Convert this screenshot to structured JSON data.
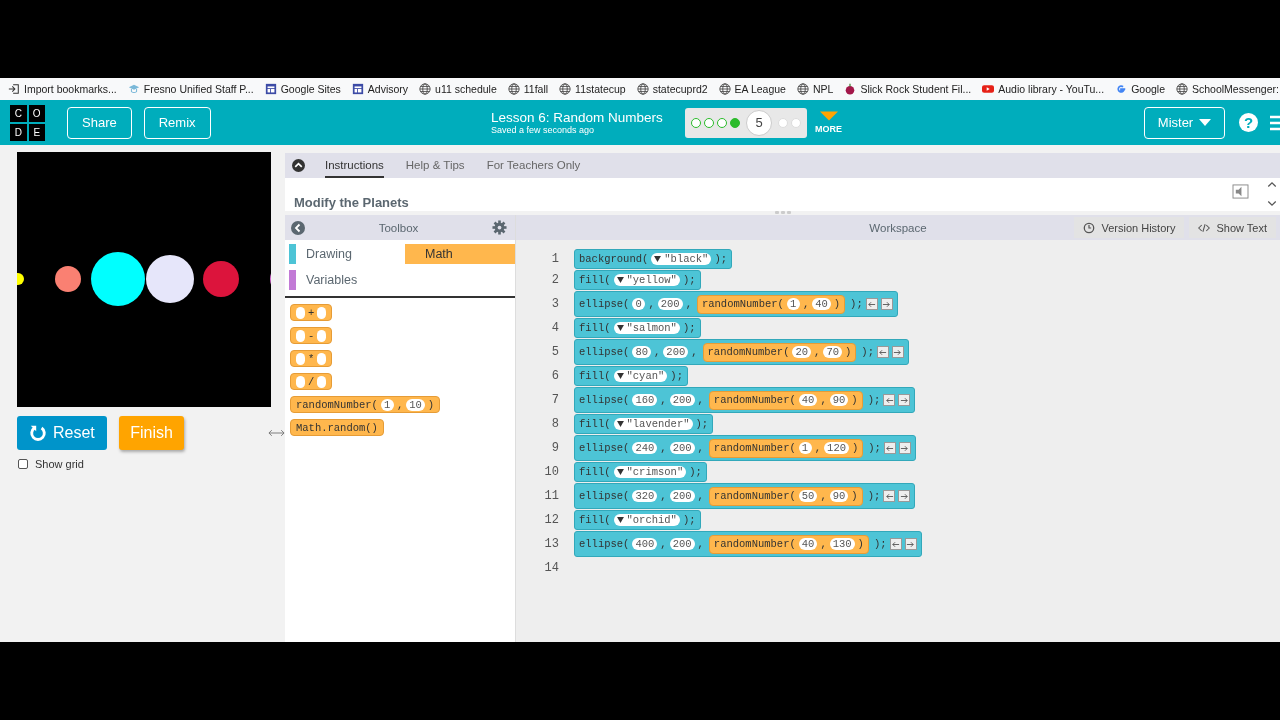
{
  "bookmarks": [
    {
      "kind": "import",
      "label": "Import bookmarks..."
    },
    {
      "kind": "cap",
      "label": "Fresno Unified Staff P..."
    },
    {
      "kind": "sites",
      "label": "Google Sites"
    },
    {
      "kind": "sites",
      "label": "Advisory"
    },
    {
      "kind": "globe",
      "label": "u11 schedule"
    },
    {
      "kind": "globe",
      "label": "11fall"
    },
    {
      "kind": "globe",
      "label": "11statecup"
    },
    {
      "kind": "globe",
      "label": "statecuprd2"
    },
    {
      "kind": "globe",
      "label": "EA League"
    },
    {
      "kind": "globe",
      "label": "NPL"
    },
    {
      "kind": "apple",
      "label": "Slick Rock Student Fil..."
    },
    {
      "kind": "youtube",
      "label": "Audio library - YouTu..."
    },
    {
      "kind": "google",
      "label": "Google"
    },
    {
      "kind": "globe",
      "label": "SchoolMessenger:"
    }
  ],
  "header": {
    "logo": [
      "C",
      "O",
      "D",
      "E"
    ],
    "buttons": [
      "Share",
      "Remix"
    ],
    "title": "Lesson 6: Random Numbers",
    "subtitle": "Saved a few seconds ago",
    "progress": [
      {
        "kind": "dot",
        "attempted": true,
        "perfect": false
      },
      {
        "kind": "dot",
        "attempted": true,
        "perfect": false
      },
      {
        "kind": "dot",
        "attempted": true,
        "perfect": false
      },
      {
        "kind": "dot",
        "attempted": true,
        "perfect": true
      },
      {
        "kind": "current",
        "label": "5"
      },
      {
        "kind": "dot",
        "attempted": false,
        "perfect": false
      },
      {
        "kind": "dot",
        "attempted": false,
        "perfect": false
      }
    ],
    "more": "MORE",
    "user": "Mister",
    "help": "?"
  },
  "stage": {
    "buttons": [
      {
        "kind": "reset",
        "label": "Reset"
      },
      {
        "kind": "finish",
        "label": "Finish"
      }
    ],
    "show_grid": {
      "label": "Show grid",
      "checked": false
    }
  },
  "instructions": {
    "tabs": [
      {
        "label": "Instructions",
        "selected": true
      },
      {
        "label": "Help & Tips",
        "selected": false
      },
      {
        "label": "For Teachers Only",
        "selected": false
      }
    ],
    "heading": "Modify the Planets"
  },
  "toolbox": {
    "title": "Toolbox",
    "categories": [
      {
        "label": "Drawing",
        "color": "#4dc4d6",
        "selected": false
      },
      {
        "label": "Math",
        "color": "#ffb74d",
        "selected": true
      },
      {
        "label": "Variables",
        "color": "#c27ad6",
        "selected": false
      }
    ],
    "blocks": [
      {
        "parts": [
          {
            "kind": "slot"
          },
          {
            "kind": "text",
            "text": "+"
          },
          {
            "kind": "slot"
          }
        ]
      },
      {
        "parts": [
          {
            "kind": "slot"
          },
          {
            "kind": "text",
            "text": "-"
          },
          {
            "kind": "slot"
          }
        ]
      },
      {
        "parts": [
          {
            "kind": "slot"
          },
          {
            "kind": "text",
            "text": "*"
          },
          {
            "kind": "slot"
          }
        ]
      },
      {
        "parts": [
          {
            "kind": "slot"
          },
          {
            "kind": "text",
            "text": "/"
          },
          {
            "kind": "slot"
          }
        ]
      },
      {
        "parts": [
          {
            "kind": "text",
            "text": "randomNumber("
          },
          {
            "kind": "num",
            "text": "1"
          },
          {
            "kind": "text",
            "text": ","
          },
          {
            "kind": "num",
            "text": "10"
          },
          {
            "kind": "text",
            "text": ")"
          }
        ]
      },
      {
        "parts": [
          {
            "kind": "text",
            "text": "Math.random()"
          }
        ]
      }
    ]
  },
  "workspace": {
    "title": "Workspace",
    "buttons": [
      {
        "kind": "history",
        "label": "Version History"
      },
      {
        "kind": "text",
        "label": "Show Text"
      }
    ],
    "lines": [
      {
        "number": "1",
        "kind": "statement",
        "arrows": false,
        "parts": [
          {
            "kind": "text",
            "text": "background("
          },
          {
            "kind": "dropdown",
            "text": "\"black\""
          },
          {
            "kind": "text",
            "text": ");"
          }
        ]
      },
      {
        "number": "2",
        "kind": "statement",
        "arrows": false,
        "parts": [
          {
            "kind": "text",
            "text": "fill("
          },
          {
            "kind": "dropdown",
            "text": "\"yellow\""
          },
          {
            "kind": "text",
            "text": ");"
          }
        ]
      },
      {
        "number": "3",
        "kind": "statement",
        "arrows": true,
        "parts": [
          {
            "kind": "text",
            "text": "ellipse("
          },
          {
            "kind": "num",
            "text": "0"
          },
          {
            "kind": "text",
            "text": ","
          },
          {
            "kind": "num",
            "text": "200"
          },
          {
            "kind": "text",
            "text": ","
          },
          {
            "kind": "block",
            "parts": [
              {
                "kind": "text",
                "text": "randomNumber("
              },
              {
                "kind": "num",
                "text": "1"
              },
              {
                "kind": "text",
                "text": ","
              },
              {
                "kind": "num",
                "text": "40"
              },
              {
                "kind": "text",
                "text": ")"
              }
            ]
          },
          {
            "kind": "text",
            "text": ");"
          }
        ]
      },
      {
        "number": "4",
        "kind": "statement",
        "arrows": false,
        "parts": [
          {
            "kind": "text",
            "text": "fill("
          },
          {
            "kind": "dropdown",
            "text": "\"salmon\""
          },
          {
            "kind": "text",
            "text": ");"
          }
        ]
      },
      {
        "number": "5",
        "kind": "statement",
        "arrows": true,
        "parts": [
          {
            "kind": "text",
            "text": "ellipse("
          },
          {
            "kind": "num",
            "text": "80"
          },
          {
            "kind": "text",
            "text": ","
          },
          {
            "kind": "num",
            "text": "200"
          },
          {
            "kind": "text",
            "text": ","
          },
          {
            "kind": "block",
            "parts": [
              {
                "kind": "text",
                "text": "randomNumber("
              },
              {
                "kind": "num",
                "text": "20"
              },
              {
                "kind": "text",
                "text": ","
              },
              {
                "kind": "num",
                "text": "70"
              },
              {
                "kind": "text",
                "text": ")"
              }
            ]
          },
          {
            "kind": "text",
            "text": ");"
          }
        ]
      },
      {
        "number": "6",
        "kind": "statement",
        "arrows": false,
        "parts": [
          {
            "kind": "text",
            "text": "fill("
          },
          {
            "kind": "dropdown",
            "text": "\"cyan\""
          },
          {
            "kind": "text",
            "text": ");"
          }
        ]
      },
      {
        "number": "7",
        "kind": "statement",
        "arrows": true,
        "parts": [
          {
            "kind": "text",
            "text": "ellipse("
          },
          {
            "kind": "num",
            "text": "160"
          },
          {
            "kind": "text",
            "text": ","
          },
          {
            "kind": "num",
            "text": "200"
          },
          {
            "kind": "text",
            "text": ","
          },
          {
            "kind": "block",
            "parts": [
              {
                "kind": "text",
                "text": "randomNumber("
              },
              {
                "kind": "num",
                "text": "40"
              },
              {
                "kind": "text",
                "text": ","
              },
              {
                "kind": "num",
                "text": "90"
              },
              {
                "kind": "text",
                "text": ")"
              }
            ]
          },
          {
            "kind": "text",
            "text": ");"
          }
        ]
      },
      {
        "number": "8",
        "kind": "statement",
        "arrows": false,
        "parts": [
          {
            "kind": "text",
            "text": "fill("
          },
          {
            "kind": "dropdown",
            "text": "\"lavender\""
          },
          {
            "kind": "text",
            "text": ");"
          }
        ]
      },
      {
        "number": "9",
        "kind": "statement",
        "arrows": true,
        "parts": [
          {
            "kind": "text",
            "text": "ellipse("
          },
          {
            "kind": "num",
            "text": "240"
          },
          {
            "kind": "text",
            "text": ","
          },
          {
            "kind": "num",
            "text": "200"
          },
          {
            "kind": "text",
            "text": ","
          },
          {
            "kind": "block",
            "parts": [
              {
                "kind": "text",
                "text": "randomNumber("
              },
              {
                "kind": "num",
                "text": "1"
              },
              {
                "kind": "text",
                "text": ","
              },
              {
                "kind": "num",
                "text": "120"
              },
              {
                "kind": "text",
                "text": ")"
              }
            ]
          },
          {
            "kind": "text",
            "text": ");"
          }
        ]
      },
      {
        "number": "10",
        "kind": "statement",
        "arrows": false,
        "parts": [
          {
            "kind": "text",
            "text": "fill("
          },
          {
            "kind": "dropdown",
            "text": "\"crimson\""
          },
          {
            "kind": "text",
            "text": ");"
          }
        ]
      },
      {
        "number": "11",
        "kind": "statement",
        "arrows": true,
        "parts": [
          {
            "kind": "text",
            "text": "ellipse("
          },
          {
            "kind": "num",
            "text": "320"
          },
          {
            "kind": "text",
            "text": ","
          },
          {
            "kind": "num",
            "text": "200"
          },
          {
            "kind": "text",
            "text": ","
          },
          {
            "kind": "block",
            "parts": [
              {
                "kind": "text",
                "text": "randomNumber("
              },
              {
                "kind": "num",
                "text": "50"
              },
              {
                "kind": "text",
                "text": ","
              },
              {
                "kind": "num",
                "text": "90"
              },
              {
                "kind": "text",
                "text": ")"
              }
            ]
          },
          {
            "kind": "text",
            "text": ");"
          }
        ]
      },
      {
        "number": "12",
        "kind": "statement",
        "arrows": false,
        "parts": [
          {
            "kind": "text",
            "text": "fill("
          },
          {
            "kind": "dropdown",
            "text": "\"orchid\""
          },
          {
            "kind": "text",
            "text": ");"
          }
        ]
      },
      {
        "number": "13",
        "kind": "statement",
        "arrows": true,
        "parts": [
          {
            "kind": "text",
            "text": "ellipse("
          },
          {
            "kind": "num",
            "text": "400"
          },
          {
            "kind": "text",
            "text": ","
          },
          {
            "kind": "num",
            "text": "200"
          },
          {
            "kind": "text",
            "text": ","
          },
          {
            "kind": "block",
            "parts": [
              {
                "kind": "text",
                "text": "randomNumber("
              },
              {
                "kind": "num",
                "text": "40"
              },
              {
                "kind": "text",
                "text": ","
              },
              {
                "kind": "num",
                "text": "130"
              },
              {
                "kind": "text",
                "text": ")"
              }
            ]
          },
          {
            "kind": "text",
            "text": ");"
          }
        ]
      },
      {
        "number": "14",
        "kind": "empty"
      }
    ]
  }
}
